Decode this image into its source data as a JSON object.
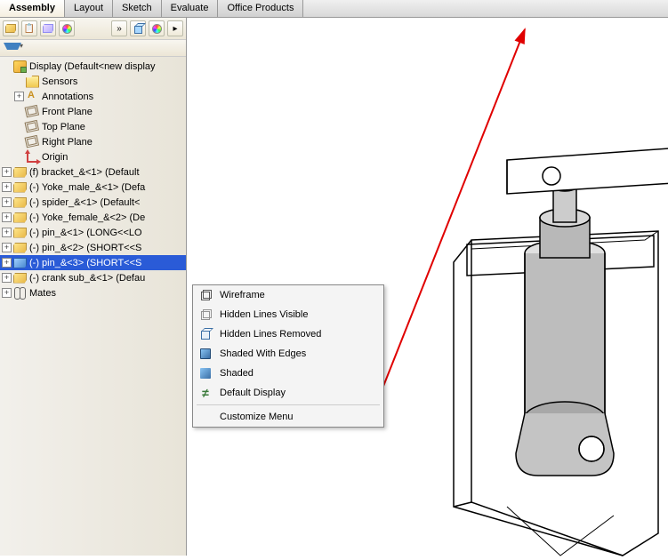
{
  "tabs": [
    "Assembly",
    "Layout",
    "Sketch",
    "Evaluate",
    "Office Products"
  ],
  "active_tab": "Assembly",
  "tree": {
    "root": "Display  (Default<new display",
    "sensors": "Sensors",
    "annotations": "Annotations",
    "front": "Front Plane",
    "top_p": "Top Plane",
    "right": "Right Plane",
    "origin": "Origin",
    "p1": "(f) bracket_&<1> (Default",
    "p2": "(-) Yoke_male_&<1> (Defa",
    "p3": "(-) spider_&<1> (Default<",
    "p4": "(-) Yoke_female_&<2> (De",
    "p5": "(-) pin_&<1> (LONG<<LO",
    "p6": "(-) pin_&<2> (SHORT<<S",
    "p7_sel": "(-) pin_&<3> (SHORT<<S",
    "p8": "(-) crank sub_&<1> (Defau",
    "mates": "Mates"
  },
  "menu": {
    "wf": "Wireframe",
    "hlv": "Hidden Lines Visible",
    "hlr": "Hidden Lines Removed",
    "swe": "Shaded With Edges",
    "shd": "Shaded",
    "def": "Default Display",
    "cust": "Customize Menu"
  },
  "chart_data": null
}
